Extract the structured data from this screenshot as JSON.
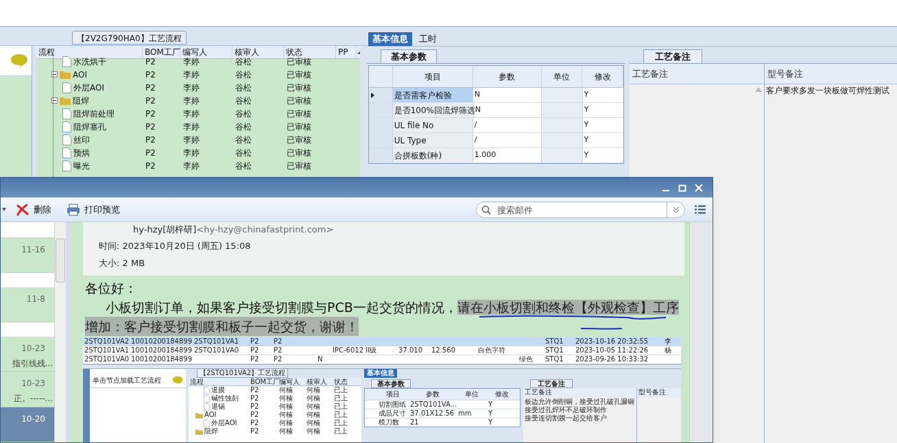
{
  "process_panel": {
    "title": "【2V2G790HA0】工艺流程",
    "columns": [
      "流程",
      "BOM工厂",
      "编写人",
      "核审人",
      "状态",
      "PP"
    ],
    "rows": [
      {
        "kind": "step",
        "name": "水洗烘干",
        "bom": "P2",
        "writer": "李婷",
        "reviewer": "谷松",
        "status": "已审核"
      },
      {
        "kind": "folder",
        "name": "AOI",
        "bom": "P2",
        "writer": "李婷",
        "reviewer": "谷松",
        "status": "已审核",
        "expanded": true,
        "children": [
          {
            "kind": "step",
            "name": "外层AOI",
            "bom": "P2",
            "writer": "李婷",
            "reviewer": "谷松",
            "status": "已审核"
          }
        ]
      },
      {
        "kind": "folder",
        "name": "阻焊",
        "bom": "P2",
        "writer": "李婷",
        "reviewer": "谷松",
        "status": "已审核",
        "expanded": true,
        "children": [
          {
            "kind": "step",
            "name": "阻焊前处理",
            "bom": "P2",
            "writer": "李婷",
            "reviewer": "谷松",
            "status": "已审核"
          },
          {
            "kind": "step",
            "name": "阻焊塞孔",
            "bom": "P2",
            "writer": "李婷",
            "reviewer": "谷松",
            "status": "已审核"
          },
          {
            "kind": "step",
            "name": "丝印",
            "bom": "P2",
            "writer": "李婷",
            "reviewer": "谷松",
            "status": "已审核"
          },
          {
            "kind": "step",
            "name": "预烘",
            "bom": "P2",
            "writer": "李婷",
            "reviewer": "谷松",
            "status": "已审核"
          },
          {
            "kind": "step",
            "name": "曝光",
            "bom": "P2",
            "writer": "李婷",
            "reviewer": "谷松",
            "status": "已审核"
          }
        ]
      }
    ]
  },
  "info_tabs": [
    {
      "label": "基本信息",
      "selected": true
    },
    {
      "label": "工时",
      "selected": false
    }
  ],
  "params_panel": {
    "tab": "基本参数",
    "columns": [
      "项目",
      "参数",
      "单位",
      "修改"
    ],
    "rows": [
      {
        "item": "是否需客户检验",
        "value": "N",
        "unit": "",
        "modify": "Y",
        "selected": true
      },
      {
        "item": "是否100%回流焊筛选",
        "value": "N",
        "unit": "",
        "modify": "Y",
        "selected": false
      },
      {
        "item": "UL file No",
        "value": "/",
        "unit": "",
        "modify": "Y",
        "selected": false
      },
      {
        "item": "UL Type",
        "value": "/",
        "unit": "",
        "modify": "Y",
        "selected": false
      },
      {
        "item": "合拼板数(种)",
        "value": "1.000",
        "unit": "",
        "modify": "Y",
        "selected": false
      }
    ]
  },
  "notes_panel": {
    "tab": "工艺备注",
    "columns": [
      "工艺备注",
      "型号备注"
    ],
    "model_note": "客户要求多发一块板做可焊性测试"
  },
  "mail_window": {
    "toolbar": [
      {
        "kind": "delete",
        "label": "删除"
      },
      {
        "kind": "print",
        "label": "打印预览"
      }
    ],
    "search": {
      "placeholder": "搜索邮件"
    },
    "mail_list": [
      {
        "date": "11-16",
        "selected": false
      },
      {
        "date": "11-8",
        "selected": false
      },
      {
        "date": "10-23",
        "snippet": "指引线残...",
        "selected": false
      },
      {
        "date": "10-23",
        "snippet": "正。-----...",
        "selected": false
      },
      {
        "date": "10-20",
        "selected": true
      }
    ],
    "sender": "hy-hzy[胡梓研]",
    "sender_address": "<hy-hzy@chinafastprint.com>",
    "time": "时间: 2023年10月20日 (周五) 15:08",
    "size": "大小: 2 MB",
    "greeting": "各位好：",
    "body_plain": "小板切割订单，如果客户接受切割膜与PCB一起交货的情况，",
    "body_highlight_1": "请在小板切割和终检【外观检查】工序",
    "body_highlight_2": "增加：客户接受切割膜和板子一起交货，谢谢！",
    "attachment": {
      "table_rows": [
        {
          "cells": [
            "2STQ101VA2",
            "10010200184899",
            "2STQ101VA1",
            "P2",
            "P2",
            "",
            "",
            "",
            "",
            "",
            "",
            "STQ1",
            "2023-10-16 20:32:55",
            "李"
          ],
          "selected": true
        },
        {
          "cells": [
            "2STQ101VA1",
            "10010200184899",
            "2STQ101VA0",
            "P2",
            "P2",
            "",
            "IPC-6012 II级",
            "37.010",
            "12.560",
            "白色字符",
            "",
            "STQ1",
            "2023-10-05 11:22:26",
            "杨"
          ],
          "selected": false
        },
        {
          "cells": [
            "2STQ101VA0",
            "10010200184899",
            "",
            "P2",
            "P2",
            "N",
            "",
            "",
            "",
            "",
            "绿色",
            "STQ1",
            "2023-09-26 10:33:32",
            ""
          ],
          "selected": false
        }
      ],
      "hint": "单击节点加载工艺流程",
      "flow_title": "【2STQ101VA2】工艺流程",
      "flow_columns": [
        "流程",
        "BOM工厂",
        "编写人",
        "核审人",
        "状态"
      ],
      "flow_rows": [
        {
          "kind": "step",
          "name": "退膜",
          "bom": "P2",
          "writer": "何楠",
          "reviewer": "何楠",
          "status": "已上"
        },
        {
          "kind": "step",
          "name": "碱性蚀刻",
          "bom": "P2",
          "writer": "何楠",
          "reviewer": "何楠",
          "status": "已上"
        },
        {
          "kind": "step",
          "name": "退锡",
          "bom": "P2",
          "writer": "何楠",
          "reviewer": "何楠",
          "status": "已上"
        },
        {
          "kind": "folder",
          "name": "AOI",
          "bom": "P2",
          "writer": "何楠",
          "reviewer": "何楠",
          "status": "已上",
          "children": [
            {
              "kind": "step",
              "name": "外层AOI",
              "bom": "P2",
              "writer": "何楠",
              "reviewer": "何楠",
              "status": "已上"
            }
          ]
        },
        {
          "kind": "folder",
          "name": "阻焊",
          "bom": "P2",
          "writer": "何楠",
          "reviewer": "何楠",
          "status": "已上"
        }
      ],
      "info_tab": "基本信息",
      "params_tab": "基本参数",
      "param_columns": [
        "项目",
        "参数",
        "单位",
        "修改"
      ],
      "param_rows": [
        {
          "item": "切割图纸",
          "value": "2STQ101VA...",
          "unit": "",
          "modify": "Y"
        },
        {
          "item": "成品尺寸",
          "value": "37.01X12.56",
          "unit": "mm",
          "modify": "Y"
        },
        {
          "item": "模刀数",
          "value": "21",
          "unit": "",
          "modify": "Y"
        }
      ],
      "notes_tab": "工艺备注",
      "notes_columns": [
        "工艺备注",
        "型号备注"
      ],
      "notes_lines": [
        "板边允许倒削铜，接受过孔破孔漏铜",
        "接受过孔焊环不足破环制作",
        "接受连切割膜一起交给客户"
      ]
    }
  }
}
